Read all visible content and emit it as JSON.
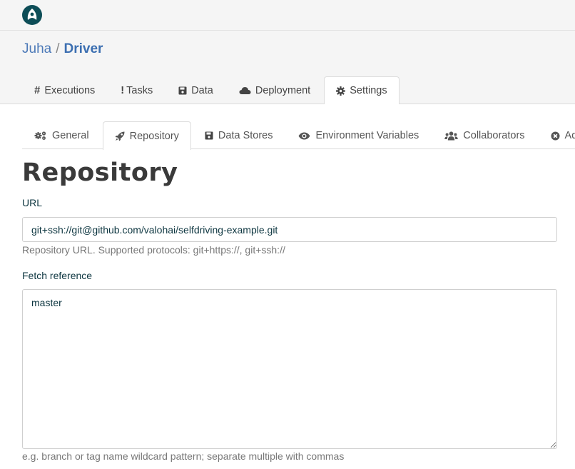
{
  "header": {
    "owner": "Juha",
    "separator": "/",
    "project": "Driver"
  },
  "main_tabs": [
    {
      "label": "Executions",
      "icon": "hash-icon"
    },
    {
      "label": "Tasks",
      "icon": "exclamation-icon"
    },
    {
      "label": "Data",
      "icon": "floppy-icon"
    },
    {
      "label": "Deployment",
      "icon": "cloud-icon"
    },
    {
      "label": "Settings",
      "icon": "cog-icon",
      "active": true
    }
  ],
  "sub_tabs": [
    {
      "label": "General",
      "icon": "cogs-icon"
    },
    {
      "label": "Repository",
      "icon": "rocket-icon",
      "active": true
    },
    {
      "label": "Data Stores",
      "icon": "floppy-icon"
    },
    {
      "label": "Environment Variables",
      "icon": "eye-icon"
    },
    {
      "label": "Collaborators",
      "icon": "users-icon"
    },
    {
      "label": "Admin",
      "icon": "close-circle-icon"
    }
  ],
  "page": {
    "title": "Repository"
  },
  "form": {
    "url_label": "URL",
    "url_value": "git+ssh://git@github.com/valohai/selfdriving-example.git",
    "url_help": "Repository URL. Supported protocols: git+https://, git+ssh://",
    "fetch_label": "Fetch reference",
    "fetch_value": "master",
    "fetch_help": "e.g. branch or tag name wildcard pattern; separate multiple with commas"
  },
  "colors": {
    "accent": "#3c6fb1",
    "logo": "#0d4d57"
  }
}
